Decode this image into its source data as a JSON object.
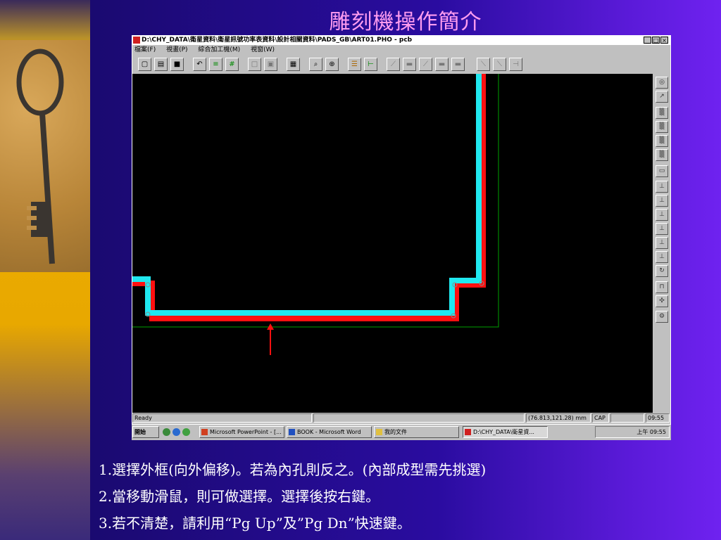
{
  "slide": {
    "title": "雕刻機操作簡介",
    "instructions": [
      "1.選擇外框(向外偏移)。若為內孔則反之。(內部成型需先挑選)",
      "2.當移動滑鼠，則可做選擇。選擇後按右鍵。",
      "3.若不清楚，請利用“Pg Up”及”Pg Dn”快速鍵。"
    ]
  },
  "window": {
    "title": "D:\\CHY_DATA\\衛星資料\\衛星訊號功率表資料\\設計相關資料\\PADS_GB\\ART01.PHO - pcb",
    "controls": {
      "minimize": "_",
      "maximize": "□",
      "close": "×"
    },
    "menu": [
      "檔案(F)",
      "視畫(P)",
      "綜合加工機(M)",
      "視窗(W)"
    ]
  },
  "toolbar_icons": [
    "new-icon",
    "open-icon",
    "save-icon",
    "undo-icon",
    "layer-icon",
    "grid-icon",
    "select-rect-icon",
    "select-window-icon",
    "calculator-icon",
    "zoom-icon",
    "zoom-in-icon",
    "layer-color-icon",
    "measure-icon",
    "tool-1-icon",
    "tool-2-icon",
    "tool-3-icon",
    "tool-4-icon",
    "tool-5-icon",
    "tool-6-icon",
    "tool-7-icon",
    "tool-8-icon"
  ],
  "right_tools": [
    "circle-tool-icon",
    "arrow-tool-icon",
    "pattern-1-icon",
    "pattern-2-icon",
    "pattern-3-icon",
    "pattern-4-icon",
    "display-icon",
    "align-1-icon",
    "align-2-icon",
    "align-3-icon",
    "align-4-icon",
    "align-5-icon",
    "align-6-icon",
    "rotate-icon",
    "drill-icon",
    "move-icon",
    "settings-icon"
  ],
  "statusbar": {
    "ready": "Ready",
    "coords": "(76.813,121.28) mm",
    "cap": "CAP",
    "time": "09:55"
  },
  "taskbar": {
    "start": "開始",
    "tasks": [
      {
        "label": "Microsoft PowerPoint - [...",
        "active": false
      },
      {
        "label": "BOOK - Microsoft Word",
        "active": false
      },
      {
        "label": "我的文件",
        "active": false
      },
      {
        "label": "D:\\CHY_DATA\\衛星資...",
        "active": true
      }
    ],
    "clock": "上午 09:55"
  },
  "colors": {
    "trace_outer": "#ff1010",
    "trace_inner": "#20e8f0",
    "board_outline": "#00a000",
    "pointer_arrow": "#ff1010",
    "title_text": "#ff9cf0"
  }
}
